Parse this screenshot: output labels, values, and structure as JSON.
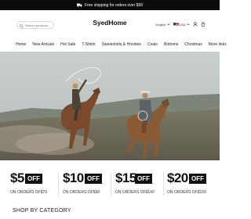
{
  "announcement": {
    "text": "Free shipping for orders over $99"
  },
  "header": {
    "logo": "SyedHome",
    "search_placeholder": "Search products",
    "language": "English",
    "currency": "USD"
  },
  "nav": {
    "items": [
      "Home",
      "New Arrivals",
      "Hot Sale",
      "T-Shirts",
      "Sweatshirts & Hoodies",
      "Coats",
      "Bottoms",
      "Christmas",
      "More links"
    ]
  },
  "hero": {
    "image": "two-cowboys-on-horses"
  },
  "coupons": [
    {
      "amount": "$5",
      "off": "OFF",
      "condition": "ON ORDERS OF$79"
    },
    {
      "amount": "$10",
      "off": "OFF",
      "condition": "ON ORDERS OF$99"
    },
    {
      "amount": "$15",
      "off": "OFF",
      "condition": "ON ORDERS OF$149"
    },
    {
      "amount": "$20",
      "off": "OFF",
      "condition": "ON ORDERS OF$199"
    }
  ],
  "section": {
    "title": "SHOP BY CATEGORY"
  }
}
